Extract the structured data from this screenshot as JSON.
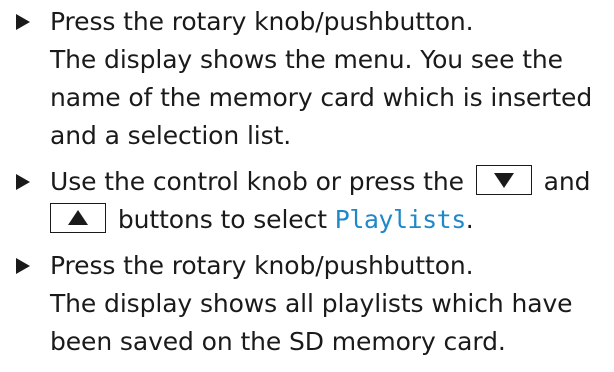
{
  "steps": [
    {
      "lines": [
        "Press the rotary knob/pushbutton.",
        "The display shows the menu. You see the",
        "name of the memory card which is inserted",
        "and a selection list."
      ]
    },
    {
      "line1_before": "Use the control knob or press the",
      "line1_after": "and",
      "line2_after": "buttons to select",
      "highlight": "Playlists",
      "highlight_color": "#1e88c9",
      "end_punct": ".",
      "button_down_icon": "down-triangle-icon",
      "button_up_icon": "up-triangle-icon"
    },
    {
      "lines": [
        "Press the rotary knob/pushbutton.",
        "The display shows all playlists which have",
        "been saved on the SD memory card."
      ]
    }
  ]
}
